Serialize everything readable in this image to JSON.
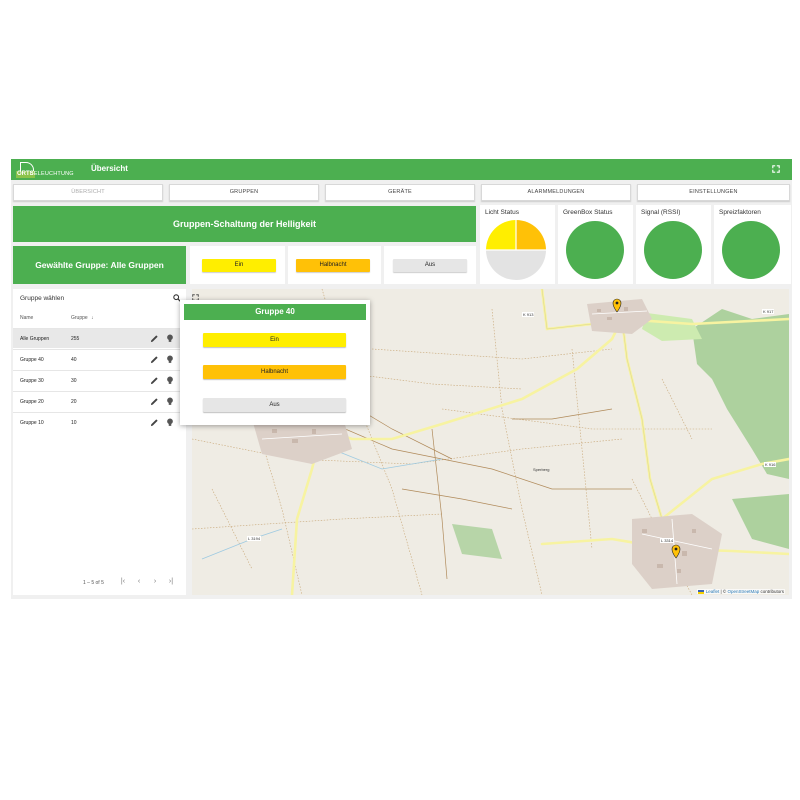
{
  "header": {
    "logo_text_1": "ORTS",
    "logo_text_2": "BELEUCHTUNG",
    "title": "Übersicht",
    "fullscreen_icon": "fullscreen-icon"
  },
  "nav": {
    "tabs": [
      {
        "label": "ÜBERSICHT"
      },
      {
        "label": "GRUPPEN"
      },
      {
        "label": "GERÄTE"
      },
      {
        "label": "ALARMMELDUNGEN"
      },
      {
        "label": "EINSTELLUNGEN"
      }
    ]
  },
  "switch_panel": {
    "title": "Gruppen-Schaltung der Helligkeit",
    "selected_group_label": "Gewählte Gruppe: Alle Gruppen",
    "btn_on": "Ein",
    "btn_half": "Halbnacht",
    "btn_off": "Aus"
  },
  "status": {
    "licht": "Licht Status",
    "greenbox": "GreenBox Status",
    "signal": "Signal (RSSI)",
    "spreiz": "Spreizfaktoren"
  },
  "groups": {
    "title": "Gruppe wählen",
    "col_name": "Name",
    "col_group": "Gruppe",
    "rows": [
      {
        "name": "Alle Gruppen",
        "group": "255"
      },
      {
        "name": "Gruppe 40",
        "group": "40"
      },
      {
        "name": "Gruppe 30",
        "group": "30"
      },
      {
        "name": "Gruppe 20",
        "group": "20"
      },
      {
        "name": "Gruppe 10",
        "group": "10"
      }
    ],
    "pagination": "1 – 5 of 5"
  },
  "popup": {
    "title": "Gruppe 40",
    "btn_on": "Ein",
    "btn_half": "Halbnacht",
    "btn_off": "Aus"
  },
  "map": {
    "road_labels": [
      "K 913",
      "K 917",
      "K 916",
      "L 3194",
      "L 3314",
      "Sperberg"
    ],
    "attribution_leaflet": "Leaflet",
    "attribution_sep": " | © ",
    "attribution_osm": "OpenStreetMap",
    "attribution_rest": " contributors"
  },
  "colors": {
    "brand_green": "#4caf50",
    "btn_yellow": "#ffee00",
    "btn_orange": "#ffc107",
    "btn_grey": "#e6e6e6"
  }
}
